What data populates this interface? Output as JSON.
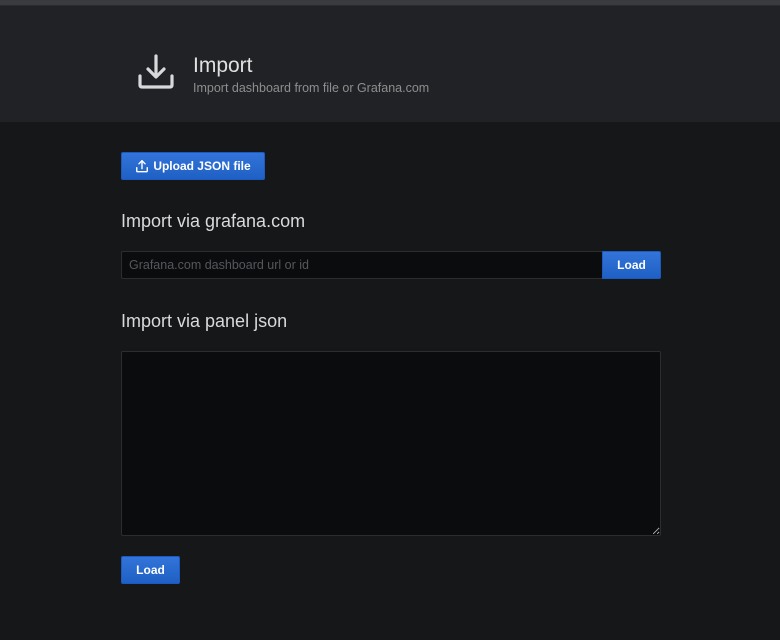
{
  "header": {
    "title": "Import",
    "subtitle": "Import dashboard from file or Grafana.com",
    "icon": "download-icon"
  },
  "upload": {
    "label": "Upload JSON file",
    "icon": "upload-icon"
  },
  "grafana_com": {
    "section_title": "Import via grafana.com",
    "input_placeholder": "Grafana.com dashboard url or id",
    "input_value": "",
    "load_label": "Load"
  },
  "panel_json": {
    "section_title": "Import via panel json",
    "textarea_value": "",
    "load_label": "Load"
  },
  "colors": {
    "background": "#161719",
    "header_background": "#202226",
    "primary_button": "#3274d9",
    "input_background": "#0b0c0e"
  }
}
